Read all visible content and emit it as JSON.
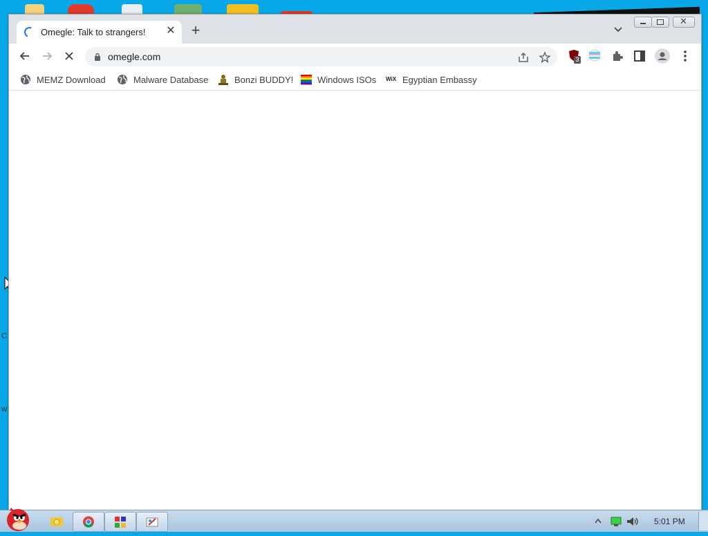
{
  "browser": {
    "tab": {
      "title": "Omegle: Talk to strangers!",
      "close_icon": "close-icon",
      "state": "loading"
    },
    "new_tab_icon": "plus-icon",
    "toolbar": {
      "url": "omegle.com",
      "extension_badge": "3"
    },
    "bookmarks": [
      {
        "label": "MEMZ Download",
        "icon": "globe-icon"
      },
      {
        "label": "Malware Database",
        "icon": "globe-icon"
      },
      {
        "label": "Bonzi BUDDY!",
        "icon": "bonzi-icon"
      },
      {
        "label": "Windows ISOs",
        "icon": "rainbow-flag-icon"
      },
      {
        "label": "Egyptian Embassy",
        "icon": "wix-icon",
        "icon_text": "WiX"
      }
    ]
  },
  "desktop": {
    "edge_letters": [
      "C",
      "W"
    ]
  },
  "taskbar": {
    "time": "5:01 PM"
  },
  "colors": {
    "desktop": "#08a8e8",
    "tabstrip": "#dee1e6",
    "accent": "#1a73e8"
  }
}
